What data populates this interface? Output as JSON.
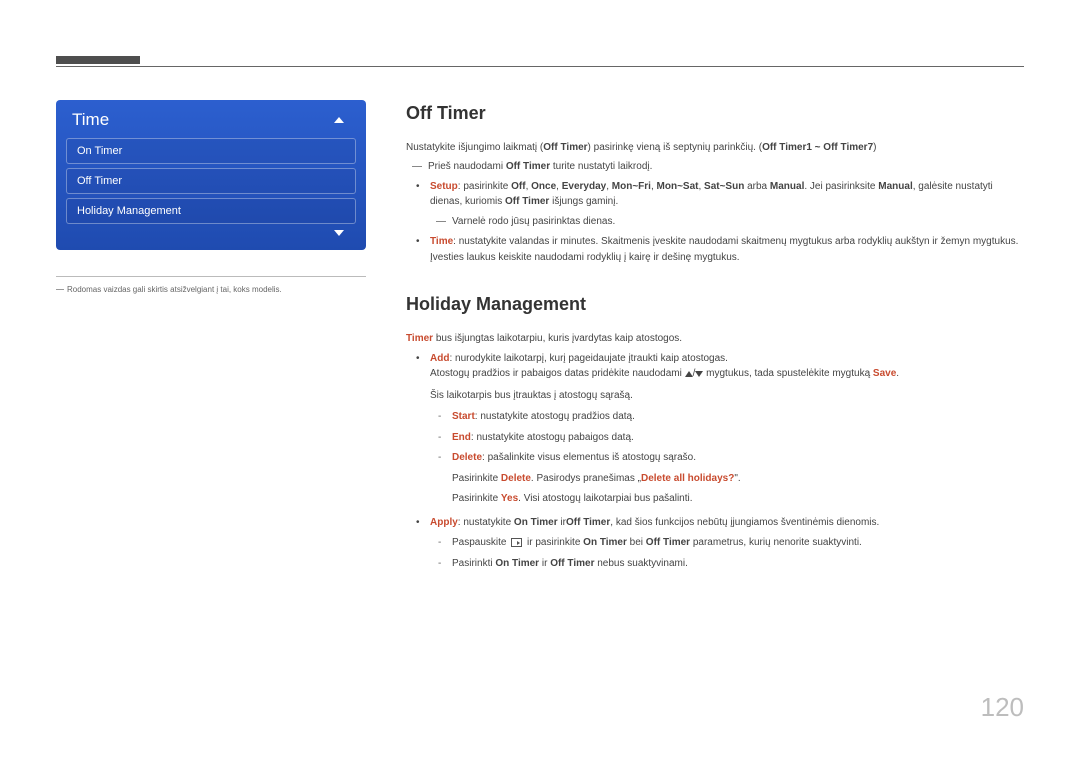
{
  "page_number": "120",
  "sidebar": {
    "title": "Time",
    "items": [
      "On Timer",
      "Off Timer",
      "Holiday Management"
    ],
    "footnote": "Rodomas vaizdas gali skirtis atsižvelgiant į tai, koks modelis."
  },
  "off_timer": {
    "heading": "Off Timer",
    "intro_pre": "Nustatykite išjungimo laikmatį (",
    "intro_bold": "Off Timer",
    "intro_post": ") pasirinkę vieną iš septynių parinkčių. (",
    "range": "Off Timer1 ~ Off Timer7",
    "intro_end": ")",
    "note_pre": "Prieš naudodami ",
    "note_bold": "Off Timer",
    "note_post": " turite nustatyti laikrodį.",
    "setup": {
      "label": "Setup",
      "text1": ": pasirinkite ",
      "opts": [
        "Off",
        "Once",
        "Everyday",
        "Mon~Fri",
        "Mon~Sat",
        "Sat~Sun"
      ],
      "or": " arba ",
      "manual": "Manual",
      "text2": ". Jei pasirinksite ",
      "text3": ", galėsite nustatyti dienas, kuriomis ",
      "off_timer": "Off Timer",
      "text4": " išjungs gaminį.",
      "subnote": "Varnelė rodo jūsų pasirinktas dienas."
    },
    "time": {
      "label": "Time",
      "text": ": nustatykite valandas ir minutes. Skaitmenis įveskite naudodami skaitmenų mygtukus arba rodyklių aukštyn ir žemyn mygtukus. Įvesties laukus keiskite naudodami rodyklių į kairę ir dešinę mygtukus."
    }
  },
  "holiday": {
    "heading": "Holiday Management",
    "intro_bold": "Timer",
    "intro_text": " bus išjungtas laikotarpiu, kuris įvardytas kaip atostogos.",
    "add": {
      "label": "Add",
      "text": ": nurodykite laikotarpį, kurį pageidaujate įtraukti kaip atostogas.",
      "line2_pre": "Atostogų pradžios ir pabaigos datas pridėkite naudodami ",
      "line2_post": " mygtukus, tada spustelėkite mygtuką ",
      "save": "Save",
      "line3": "Šis laikotarpis bus įtrauktas į atostogų sąrašą.",
      "start_label": "Start",
      "start_text": ": nustatykite atostogų pradžios datą.",
      "end_label": "End",
      "end_text": ": nustatykite atostogų pabaigos datą.",
      "delete_label": "Delete",
      "delete_text": ": pašalinkite visus elementus iš atostogų sąrašo.",
      "delete_line2_pre": "Pasirinkite ",
      "delete_btn": "Delete",
      "delete_line2_mid": ". Pasirodys pranešimas „",
      "delete_msg": "Delete all holidays?",
      "delete_line2_end": "\".",
      "delete_line3_pre": "Pasirinkite ",
      "yes": "Yes",
      "delete_line3_post": ". Visi atostogų laikotarpiai bus pašalinti."
    },
    "apply": {
      "label": "Apply",
      "text1": ": nustatykite ",
      "on_timer": "On Timer",
      "text2": " ir",
      "off_timer": "Off Timer",
      "text3": ", kad šios funkcijos nebūtų įjungiamos šventinėmis dienomis.",
      "sub1_pre": "Paspauskite ",
      "sub1_mid": " ir pasirinkite ",
      "sub1_bei": " bei ",
      "sub1_post": " parametrus, kurių nenorite suaktyvinti.",
      "sub2_pre": "Pasirinkti ",
      "sub2_ir": " ir ",
      "sub2_post": " nebus suaktyvinami."
    }
  }
}
